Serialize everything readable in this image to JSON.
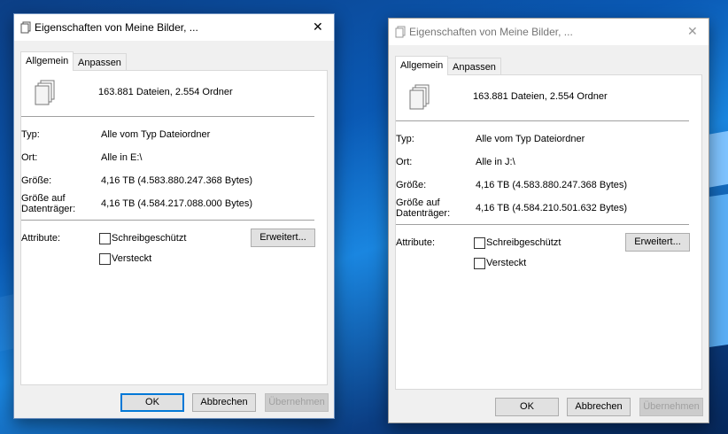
{
  "windows": [
    {
      "title": "Eigenschaften von Meine Bilder, ...",
      "close_glyph": "✕",
      "tabs": [
        {
          "label": "Allgemein"
        },
        {
          "label": "Anpassen"
        }
      ],
      "summary": "163.881 Dateien, 2.554 Ordner",
      "type_label": "Typ:",
      "type_value": "Alle vom Typ Dateiordner",
      "location_label": "Ort:",
      "location_value": "Alle in E:\\",
      "size_label": "Größe:",
      "size_value": "4,16 TB (4.583.880.247.368 Bytes)",
      "disk_size_label_1": "Größe auf",
      "disk_size_label_2": "Datenträger:",
      "disk_size_value": "4,16 TB (4.584.217.088.000 Bytes)",
      "attributes_label": "Attribute:",
      "readonly_label": "Schreibgeschützt",
      "hidden_label": "Versteckt",
      "advanced_button": "Erweitert...",
      "ok_button": "OK",
      "cancel_button": "Abbrechen",
      "apply_button": "Übernehmen"
    },
    {
      "title": "Eigenschaften von Meine Bilder, ...",
      "close_glyph": "✕",
      "tabs": [
        {
          "label": "Allgemein"
        },
        {
          "label": "Anpassen"
        }
      ],
      "summary": "163.881 Dateien, 2.554 Ordner",
      "type_label": "Typ:",
      "type_value": "Alle vom Typ Dateiordner",
      "location_label": "Ort:",
      "location_value": "Alle in J:\\",
      "size_label": "Größe:",
      "size_value": "4,16 TB (4.583.880.247.368 Bytes)",
      "disk_size_label_1": "Größe auf",
      "disk_size_label_2": "Datenträger:",
      "disk_size_value": "4,16 TB (4.584.210.501.632 Bytes)",
      "attributes_label": "Attribute:",
      "readonly_label": "Schreibgeschützt",
      "hidden_label": "Versteckt",
      "advanced_button": "Erweitert...",
      "ok_button": "OK",
      "cancel_button": "Abbrechen",
      "apply_button": "Übernehmen"
    }
  ],
  "colors": {
    "accent": "#0078d7",
    "desktop": "#0a59b4"
  }
}
